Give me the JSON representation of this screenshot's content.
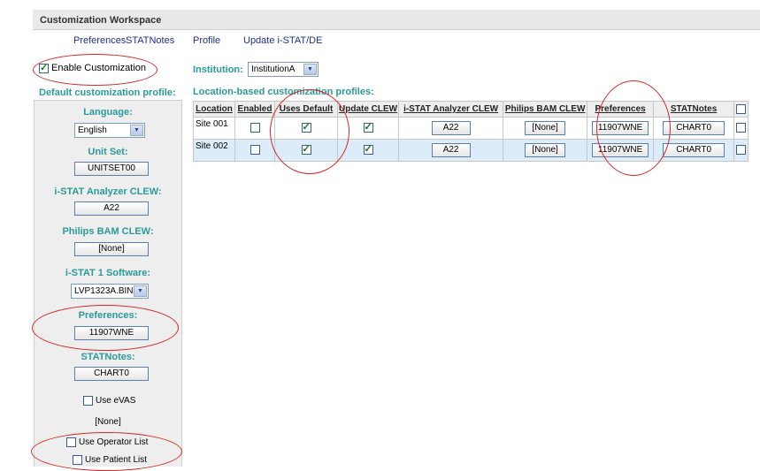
{
  "header": {
    "title": "Customization Workspace"
  },
  "tabs": [
    {
      "label": "Preferences"
    },
    {
      "label": "STATNotes"
    },
    {
      "label": "Profile"
    },
    {
      "label": "Update i-STAT/DE"
    }
  ],
  "enable_customization": {
    "label": "Enable Customization",
    "checked": true
  },
  "default_profile": {
    "title": "Default customization profile:",
    "language": {
      "label": "Language:",
      "value": "English"
    },
    "unit_set": {
      "label": "Unit Set:",
      "value": "UNITSET00"
    },
    "istat_clew": {
      "label": "i-STAT Analyzer CLEW:",
      "value": "A22"
    },
    "philips_clew": {
      "label": "Philips BAM CLEW:",
      "value": "[None]"
    },
    "istat1_software": {
      "label": "i-STAT 1 Software:",
      "value": "LVP1323A.BIN"
    },
    "preferences": {
      "label": "Preferences:",
      "value": "11907WNE"
    },
    "statnotes": {
      "label": "STATNotes:",
      "value": "CHART0"
    },
    "use_evas": {
      "label": "Use eVAS",
      "value": "[None]",
      "checked": false
    },
    "use_operator_list": {
      "label": "Use Operator List",
      "checked": false
    },
    "use_patient_list": {
      "label": "Use Patient List",
      "checked": false
    }
  },
  "institution": {
    "label": "Institution:",
    "value": "InstitutionA"
  },
  "location_profiles": {
    "title": "Location-based customization profiles:",
    "columns": [
      "Location",
      "Enabled",
      "Uses Default",
      "Update CLEW",
      "i-STAT Analyzer CLEW",
      "Philips BAM CLEW",
      "Preferences",
      "STATNotes"
    ],
    "rows": [
      {
        "location": "Site 001",
        "enabled": false,
        "uses_default": true,
        "update_clew": true,
        "istat_clew": "A22",
        "philips_clew": "[None]",
        "preferences": "11907WNE",
        "statnotes": "CHART0"
      },
      {
        "location": "Site 002",
        "enabled": false,
        "uses_default": true,
        "update_clew": true,
        "istat_clew": "A22",
        "philips_clew": "[None]",
        "preferences": "11907WNE",
        "statnotes": "CHART0"
      }
    ]
  },
  "colors": {
    "accent_teal": "#2b9a9a",
    "link_blue": "#1f2f8f",
    "annotation_red": "#d42626",
    "row_highlight": "#dcecf8"
  },
  "icons": {
    "dropdown": "chevron-down-icon",
    "checkbox": "checkbox-icon"
  }
}
